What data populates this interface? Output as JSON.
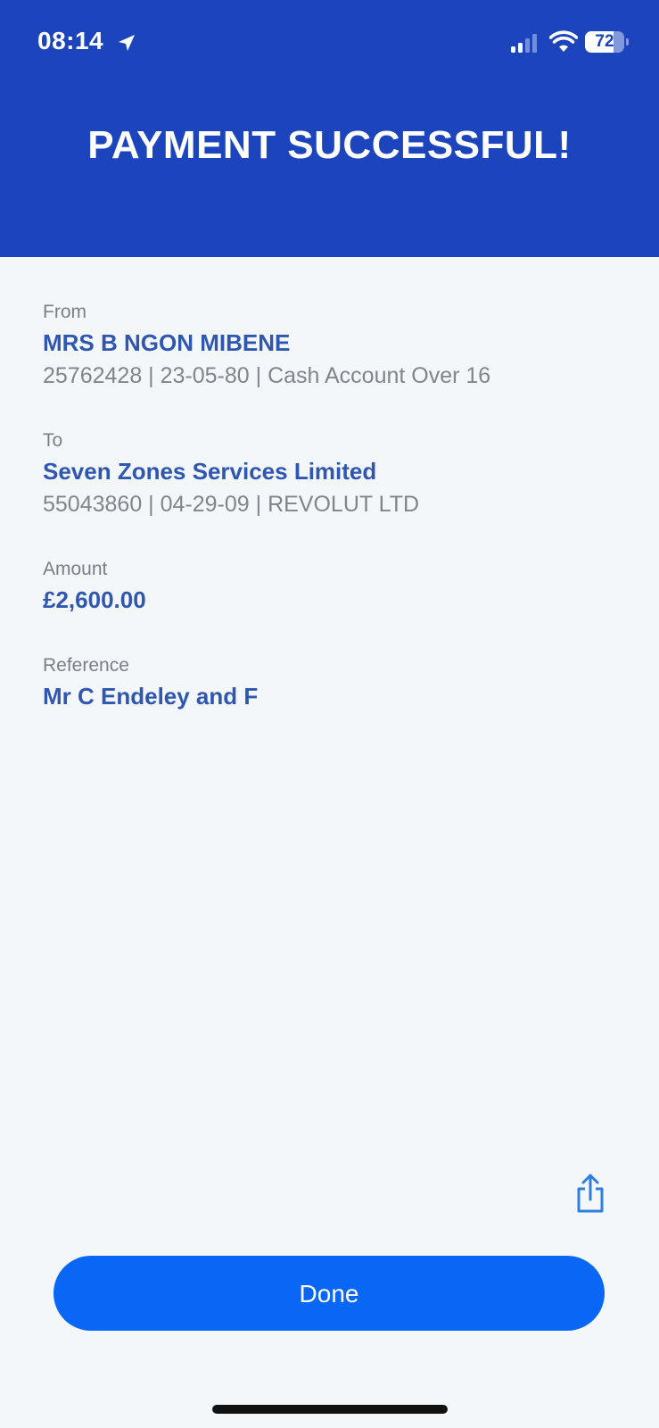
{
  "status_bar": {
    "time": "08:14",
    "battery_level": "72",
    "battery_fraction": 0.72,
    "icons": [
      "location-arrow-icon",
      "cellular-signal-icon",
      "wifi-icon",
      "battery-icon"
    ]
  },
  "header": {
    "title": "PAYMENT SUCCESSFUL!",
    "background": "#1b44bd"
  },
  "details": {
    "from": {
      "label": "From",
      "name": "MRS B NGON MIBENE",
      "account": "25762428 | 23-05-80 | Cash Account Over 16"
    },
    "to": {
      "label": "To",
      "name": "Seven Zones Services Limited",
      "account": "55043860 | 04-29-09 | REVOLUT LTD"
    },
    "amount": {
      "label": "Amount",
      "value": "£2,600.00"
    },
    "reference": {
      "label": "Reference",
      "value": "Mr C Endeley and F"
    }
  },
  "actions": {
    "share_icon": "share-icon",
    "done_label": "Done",
    "done_color": "#0a66f5"
  },
  "colors": {
    "accent": "#2f57b2",
    "muted_text": "#7a7f86",
    "page_background": "#f4f7fa"
  }
}
